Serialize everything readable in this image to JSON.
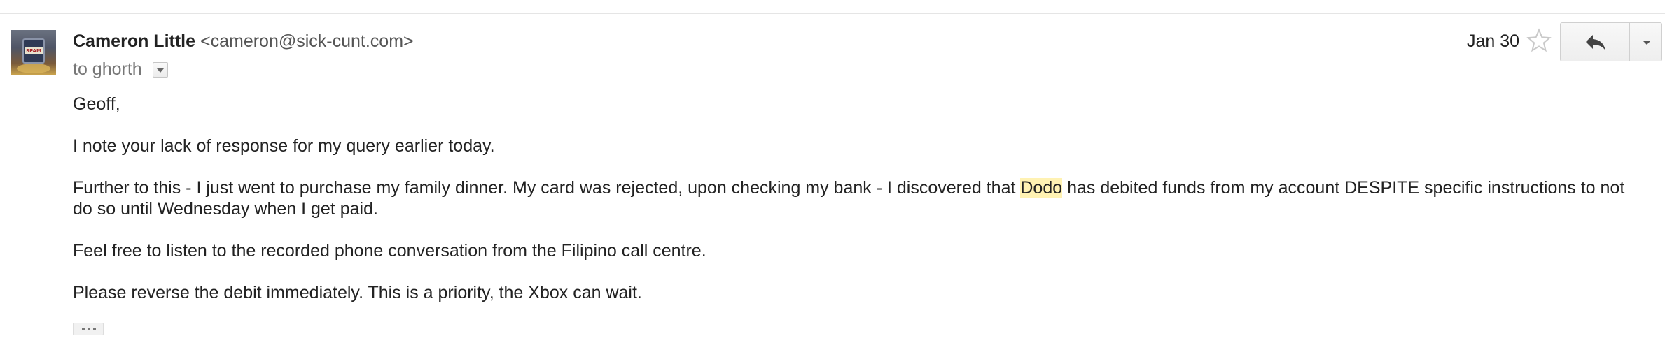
{
  "message": {
    "sender_name": "Cameron Little",
    "sender_email": "<cameron@sick-cunt.com>",
    "recipient_line": "to ghorth",
    "date": "Jan 30",
    "avatar_alt": "SPAM",
    "body": {
      "greeting": "Geoff,",
      "paragraph_1": "I note your lack of response for my query earlier today.",
      "paragraph_2_before": "Further to this - I just went to purchase my family dinner. My card was rejected, upon checking my bank - I discovered that ",
      "paragraph_2_highlight": "Dodo",
      "paragraph_2_after": " has debited funds from my account DESPITE specific instructions to not do so until Wednesday when I get paid.",
      "paragraph_3": "Feel free to listen to the recorded phone conversation from the Filipino call centre.",
      "paragraph_4": "Please reverse the debit immediately. This is a priority, the Xbox can wait."
    }
  },
  "icons": {
    "star": "star-icon",
    "reply": "reply-icon",
    "more": "chevron-down-icon",
    "details": "chevron-down-icon",
    "trimmed": "ellipsis-icon"
  },
  "colors": {
    "highlight": "#fff2b3",
    "text": "#222222",
    "secondary_text": "#777777"
  }
}
